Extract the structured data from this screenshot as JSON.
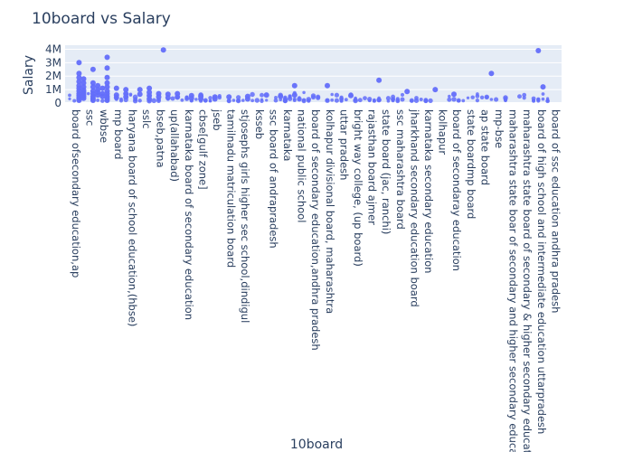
{
  "chart_data": {
    "type": "scatter",
    "title": "10board vs Salary",
    "xlabel": "10board",
    "ylabel": "Salary",
    "ylim": [
      0,
      4300000
    ],
    "y_ticks": [
      0,
      1000000,
      2000000,
      3000000,
      4000000
    ],
    "y_tick_labels": [
      "0",
      "1M",
      "2M",
      "3M",
      "4M"
    ],
    "grid": true,
    "plot_background": "#e5ecf6",
    "marker_color": "#636efa",
    "category_labels": [
      "board of ssc education andhra pradesh",
      "board of high school and intermediate education uttarpradesh",
      "maharashtra state board of secondary & higher secondary education",
      "maharashtra state boar of secondary and higher secondary education",
      "mp-bse",
      "ap state board",
      "state boardmp board",
      "board of secondaray education",
      "kolhapur",
      "karnataka secondary education",
      "jharkhand secondary education board",
      "ssc maharashtra board",
      "state board (jac, ranchi)",
      "rajasthan board ajmer",
      "bright way college, (up board)",
      "uttar pradesh",
      "kolhapur divisional board, maharashtra",
      "board of secondary education,andhra pradesh",
      "national public school",
      "karnataka",
      "ssc board of andrapradesh",
      "ksseb",
      "stjosephs girls higher sec school,dindigul",
      "tamilnadu matriculation board",
      "jseb",
      "cbse[gulf zone]",
      "karnataka board of secondary education",
      "up(allahabad)",
      "bseb,patna",
      "sslc",
      "haryana board of school education,(hbse)",
      "mp board",
      "wbbse",
      "ssc",
      "board ofsecondary education,ap"
    ],
    "points": [
      {
        "c": 2,
        "y": 3000000
      },
      {
        "c": 2,
        "y": 2200000
      },
      {
        "c": 2,
        "y": 1900000
      },
      {
        "c": 2,
        "y": 1600000
      },
      {
        "c": 2,
        "y": 1300000
      },
      {
        "c": 2,
        "y": 1100000
      },
      {
        "c": 2,
        "y": 900000
      },
      {
        "c": 2,
        "y": 700000
      },
      {
        "c": 2,
        "y": 550000
      },
      {
        "c": 2,
        "y": 400000
      },
      {
        "c": 2,
        "y": 300000
      },
      {
        "c": 2,
        "y": 200000
      },
      {
        "c": 3,
        "y": 1800000
      },
      {
        "c": 3,
        "y": 1500000
      },
      {
        "c": 3,
        "y": 1200000
      },
      {
        "c": 3,
        "y": 950000
      },
      {
        "c": 3,
        "y": 800000
      },
      {
        "c": 3,
        "y": 650000
      },
      {
        "c": 3,
        "y": 500000
      },
      {
        "c": 3,
        "y": 350000
      },
      {
        "c": 5,
        "y": 2500000
      },
      {
        "c": 5,
        "y": 1500000
      },
      {
        "c": 5,
        "y": 1200000
      },
      {
        "c": 5,
        "y": 900000
      },
      {
        "c": 5,
        "y": 700000
      },
      {
        "c": 5,
        "y": 500000
      },
      {
        "c": 5,
        "y": 350000
      },
      {
        "c": 5,
        "y": 200000
      },
      {
        "c": 6,
        "y": 1300000
      },
      {
        "c": 6,
        "y": 1000000
      },
      {
        "c": 6,
        "y": 800000
      },
      {
        "c": 6,
        "y": 600000
      },
      {
        "c": 7,
        "y": 1100000
      },
      {
        "c": 7,
        "y": 700000
      },
      {
        "c": 7,
        "y": 500000
      },
      {
        "c": 8,
        "y": 3400000
      },
      {
        "c": 8,
        "y": 2600000
      },
      {
        "c": 8,
        "y": 1900000
      },
      {
        "c": 8,
        "y": 1500000
      },
      {
        "c": 8,
        "y": 1200000
      },
      {
        "c": 8,
        "y": 900000
      },
      {
        "c": 8,
        "y": 700000
      },
      {
        "c": 8,
        "y": 500000
      },
      {
        "c": 8,
        "y": 350000
      },
      {
        "c": 8,
        "y": 200000
      },
      {
        "c": 10,
        "y": 1100000
      },
      {
        "c": 10,
        "y": 600000
      },
      {
        "c": 10,
        "y": 400000
      },
      {
        "c": 12,
        "y": 1000000
      },
      {
        "c": 12,
        "y": 700000
      },
      {
        "c": 12,
        "y": 450000
      },
      {
        "c": 15,
        "y": 1000000
      },
      {
        "c": 15,
        "y": 650000
      },
      {
        "c": 17,
        "y": 1100000
      },
      {
        "c": 17,
        "y": 800000
      },
      {
        "c": 17,
        "y": 550000
      },
      {
        "c": 17,
        "y": 300000
      },
      {
        "c": 19,
        "y": 700000
      },
      {
        "c": 19,
        "y": 450000
      },
      {
        "c": 20,
        "y": 3950000
      },
      {
        "c": 21,
        "y": 650000
      },
      {
        "c": 21,
        "y": 400000
      },
      {
        "c": 23,
        "y": 700000
      },
      {
        "c": 23,
        "y": 450000
      },
      {
        "c": 26,
        "y": 550000
      },
      {
        "c": 26,
        "y": 350000
      },
      {
        "c": 28,
        "y": 500000
      },
      {
        "c": 28,
        "y": 300000
      },
      {
        "c": 31,
        "y": 450000
      },
      {
        "c": 31,
        "y": 300000
      },
      {
        "c": 34,
        "y": 450000
      },
      {
        "c": 38,
        "y": 500000
      },
      {
        "c": 38,
        "y": 300000
      },
      {
        "c": 42,
        "y": 600000
      },
      {
        "c": 45,
        "y": 500000
      },
      {
        "c": 48,
        "y": 1300000
      },
      {
        "c": 48,
        "y": 600000
      },
      {
        "c": 55,
        "y": 1300000
      },
      {
        "c": 60,
        "y": 550000
      },
      {
        "c": 66,
        "y": 1700000
      },
      {
        "c": 72,
        "y": 850000
      },
      {
        "c": 78,
        "y": 1000000
      },
      {
        "c": 82,
        "y": 650000
      },
      {
        "c": 90,
        "y": 2200000
      },
      {
        "c": 100,
        "y": 3900000
      },
      {
        "c": 101,
        "y": 1200000
      }
    ],
    "noise_count": 190,
    "noise_seed": 7
  }
}
